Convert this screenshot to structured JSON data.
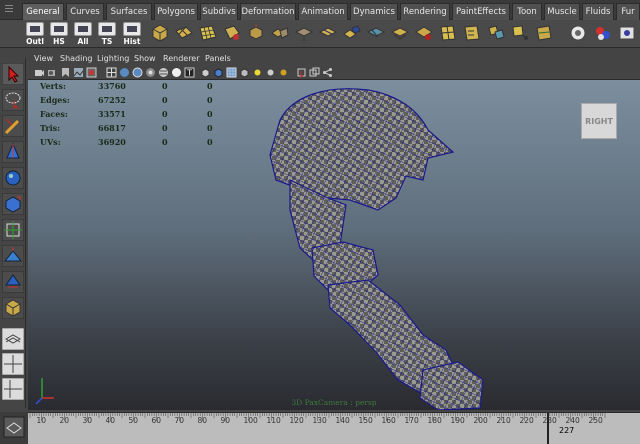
{
  "shelf_tabs": [
    "General",
    "Curves",
    "Surfaces",
    "Polygons",
    "Subdivs",
    "Deformation",
    "Animation",
    "Dynamics",
    "Rendering",
    "PaintEffects",
    "Toon",
    "Muscle",
    "Fluids",
    "Fur"
  ],
  "active_tab": "General",
  "shelf_buttons": [
    "Outl",
    "HS",
    "All",
    "TS",
    "Hist"
  ],
  "panel_menu": [
    "View",
    "Shading",
    "Lighting",
    "Show",
    "Renderer",
    "Panels"
  ],
  "hud": {
    "rows": [
      {
        "label": "Verts:",
        "value": "33760",
        "sel": "0",
        "comp": "0"
      },
      {
        "label": "Edges:",
        "value": "67252",
        "sel": "0",
        "comp": "0"
      },
      {
        "label": "Faces:",
        "value": "33571",
        "sel": "0",
        "comp": "0"
      },
      {
        "label": "Tris:",
        "value": "66817",
        "sel": "0",
        "comp": "0"
      },
      {
        "label": "UVs:",
        "value": "36920",
        "sel": "0",
        "comp": "0"
      }
    ]
  },
  "viewcube_label": "RIGHT",
  "camera_label": "3D PaxCamera : persp",
  "time_slider": {
    "ticks": [
      "10",
      "20",
      "30",
      "40",
      "50",
      "60",
      "70",
      "80",
      "90",
      "100",
      "110",
      "120",
      "130",
      "140",
      "150",
      "160",
      "170",
      "180",
      "190",
      "200",
      "210",
      "220",
      "230",
      "240",
      "250"
    ],
    "current_frame": "227"
  },
  "colors": {
    "wire": "#1a1a8c",
    "mesh_fill": "#8a8a80",
    "viewport_top": "#7c8f9f",
    "viewport_bottom": "#2a2b30",
    "hud_text": "#1b2a18",
    "accent": "#c02020"
  }
}
